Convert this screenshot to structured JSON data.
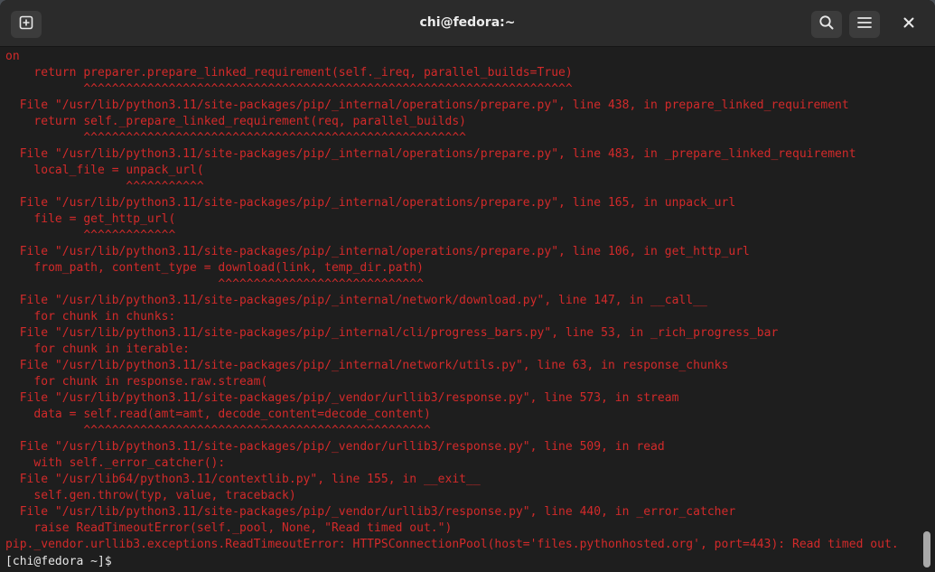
{
  "window": {
    "title": "chi@fedora:~"
  },
  "toolbar": {
    "new_tab_icon": "new-tab-icon",
    "search_icon": "search-icon",
    "menu_icon": "hamburger-menu-icon",
    "close_icon": "close-icon"
  },
  "colors": {
    "error_text": "#d22a2a",
    "prompt_text": "#e6e6e6",
    "background": "#1e1e1e"
  },
  "terminal": {
    "lines": [
      "on",
      "    return preparer.prepare_linked_requirement(self._ireq, parallel_builds=True)",
      "           ^^^^^^^^^^^^^^^^^^^^^^^^^^^^^^^^^^^^^^^^^^^^^^^^^^^^^^^^^^^^^^^^^^^^^",
      "  File \"/usr/lib/python3.11/site-packages/pip/_internal/operations/prepare.py\", line 438, in prepare_linked_requirement",
      "    return self._prepare_linked_requirement(req, parallel_builds)",
      "           ^^^^^^^^^^^^^^^^^^^^^^^^^^^^^^^^^^^^^^^^^^^^^^^^^^^^^^",
      "  File \"/usr/lib/python3.11/site-packages/pip/_internal/operations/prepare.py\", line 483, in _prepare_linked_requirement",
      "    local_file = unpack_url(",
      "                 ^^^^^^^^^^^",
      "  File \"/usr/lib/python3.11/site-packages/pip/_internal/operations/prepare.py\", line 165, in unpack_url",
      "    file = get_http_url(",
      "           ^^^^^^^^^^^^^",
      "  File \"/usr/lib/python3.11/site-packages/pip/_internal/operations/prepare.py\", line 106, in get_http_url",
      "    from_path, content_type = download(link, temp_dir.path)",
      "                              ^^^^^^^^^^^^^^^^^^^^^^^^^^^^^",
      "  File \"/usr/lib/python3.11/site-packages/pip/_internal/network/download.py\", line 147, in __call__",
      "    for chunk in chunks:",
      "  File \"/usr/lib/python3.11/site-packages/pip/_internal/cli/progress_bars.py\", line 53, in _rich_progress_bar",
      "    for chunk in iterable:",
      "  File \"/usr/lib/python3.11/site-packages/pip/_internal/network/utils.py\", line 63, in response_chunks",
      "    for chunk in response.raw.stream(",
      "  File \"/usr/lib/python3.11/site-packages/pip/_vendor/urllib3/response.py\", line 573, in stream",
      "    data = self.read(amt=amt, decode_content=decode_content)",
      "           ^^^^^^^^^^^^^^^^^^^^^^^^^^^^^^^^^^^^^^^^^^^^^^^^^",
      "  File \"/usr/lib/python3.11/site-packages/pip/_vendor/urllib3/response.py\", line 509, in read",
      "    with self._error_catcher():",
      "  File \"/usr/lib64/python3.11/contextlib.py\", line 155, in __exit__",
      "    self.gen.throw(typ, value, traceback)",
      "  File \"/usr/lib/python3.11/site-packages/pip/_vendor/urllib3/response.py\", line 440, in _error_catcher",
      "    raise ReadTimeoutError(self._pool, None, \"Read timed out.\")",
      "pip._vendor.urllib3.exceptions.ReadTimeoutError: HTTPSConnectionPool(host='files.pythonhosted.org', port=443): Read timed out."
    ],
    "prompt": "[chi@fedora ~]$ "
  }
}
